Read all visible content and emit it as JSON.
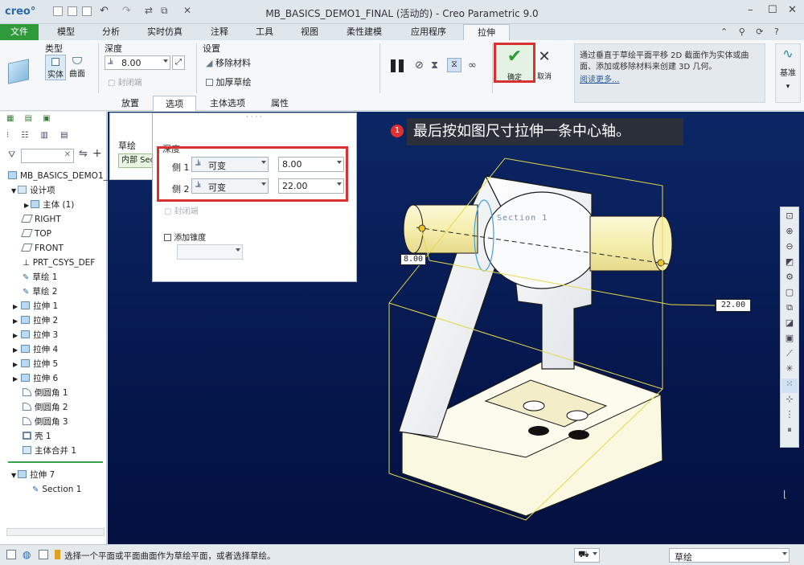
{
  "window": {
    "logo": "creo°",
    "title": "MB_BASICS_DEMO1_FINAL (活动的) - Creo Parametric 9.0"
  },
  "menu": {
    "file": "文件",
    "tabs": [
      "模型",
      "分析",
      "实时仿真",
      "注释",
      "工具",
      "视图",
      "柔性建模",
      "应用程序"
    ],
    "active": "拉伸"
  },
  "ribbon": {
    "type_label": "类型",
    "solid": "实体",
    "surface": "曲面",
    "depth_label": "深度",
    "depth_value": "8.00",
    "closed_end": "封闭端",
    "settings_label": "设置",
    "remove_material": "移除材料",
    "thicken_sketch": "加厚草绘",
    "ok": "确定",
    "cancel": "取消",
    "info": "通过垂直于草绘平面平移 2D 截面作为实体或曲面、添加或移除材料来创建 3D 几何。",
    "read_more": "阅读更多...",
    "datum": "基准"
  },
  "subtabs": [
    "放置",
    "选项",
    "主体选项",
    "属性"
  ],
  "options_panel": {
    "depth": "深度",
    "side1_label": "侧 1",
    "side1_type": "可变",
    "side1_value": "8.00",
    "side2_label": "侧 2",
    "side2_type": "可变",
    "side2_value": "22.00",
    "closed_end": "封闭端",
    "add_taper": "添加锥度"
  },
  "placement": {
    "sketch": "草绘",
    "internal": "内部 Sec"
  },
  "tree": {
    "root": "MB_BASICS_DEMO1_",
    "items": [
      "设计项",
      "主体 (1)",
      "RIGHT",
      "TOP",
      "FRONT",
      "PRT_CSYS_DEF",
      "草绘 1",
      "草绘 2",
      "拉伸 1",
      "拉伸 2",
      "拉伸 3",
      "拉伸 4",
      "拉伸 5",
      "拉伸 6",
      "倒圆角 1",
      "倒圆角 2",
      "倒圆角 3",
      "壳 1",
      "主体合并 1",
      "拉伸 7",
      "Section 1"
    ]
  },
  "viewport": {
    "callout_num": "1",
    "callout": "最后按如图尺寸拉伸一条中心轴。",
    "dim1": "8.00",
    "dim2": "22.00",
    "section": "Section 1"
  },
  "status": {
    "message": "选择一个平面或平面曲面作为草绘平面，或者选择草绘。",
    "filter": "草绘"
  },
  "colors": {
    "accent_green": "#2f9a3a",
    "highlight_red": "#d93030"
  }
}
